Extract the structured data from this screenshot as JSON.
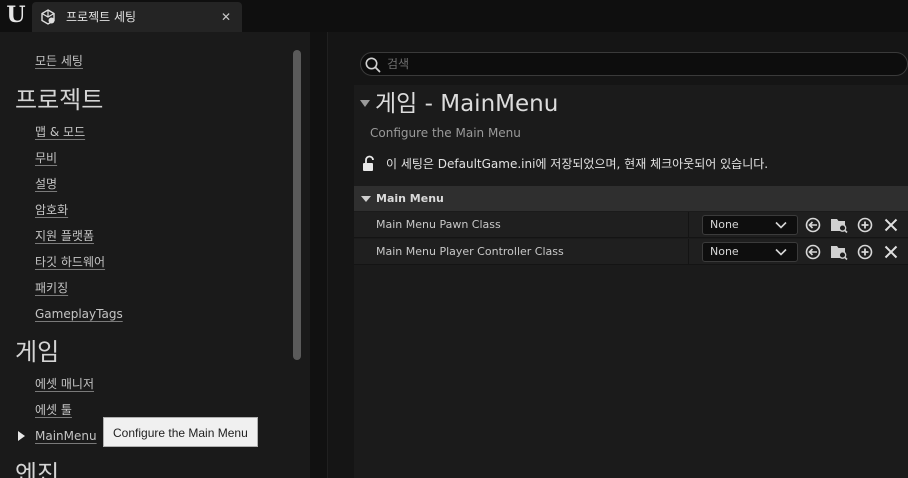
{
  "window": {
    "tab_title": "프로젝트 세팅"
  },
  "sidebar": {
    "all_settings": "모든 세팅",
    "categories": [
      {
        "title": "프로젝트",
        "items": [
          "맵 & 모드",
          "무비",
          "설명",
          "암호화",
          "지원 플랫폼",
          "타깃 하드웨어",
          "패키징",
          "GameplayTags"
        ]
      },
      {
        "title": "게임",
        "items": [
          "에셋 매니저",
          "에셋 툴",
          "MainMenu"
        ]
      },
      {
        "title": "엔진",
        "items": []
      }
    ],
    "selected_item": "MainMenu",
    "tooltip": "Configure the Main Menu"
  },
  "search": {
    "placeholder": "검색",
    "value": ""
  },
  "settings": {
    "title": "게임 - MainMenu",
    "description": "Configure the Main Menu",
    "save_notice": "이 세팅은 DefaultGame.ini에 저장되었으며, 현재 체크아웃되어 있습니다.",
    "category": "Main Menu",
    "properties": [
      {
        "label": "Main Menu Pawn Class",
        "value": "None"
      },
      {
        "label": "Main Menu Player Controller Class",
        "value": "None"
      }
    ]
  },
  "icons": {
    "engine_logo": "unreal-logo-icon",
    "tab": "settings-cube-icon",
    "close": "close-icon",
    "search": "search-icon",
    "lock": "unlock-icon",
    "row_buttons": [
      "browse-back-icon",
      "browse-folder-icon",
      "add-icon",
      "clear-icon"
    ]
  },
  "colors": {
    "background": "#151515",
    "panel": "#1b1b1b",
    "category_header": "#2f2f2f",
    "tooltip": "#f0f0f0"
  }
}
